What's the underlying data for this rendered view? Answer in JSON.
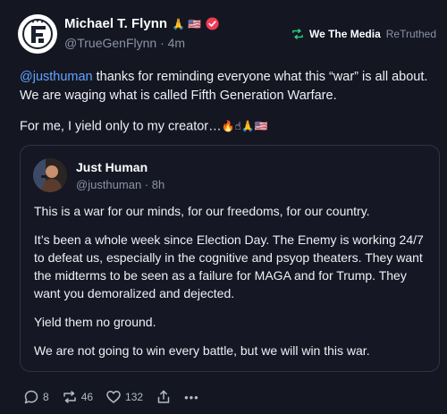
{
  "author": {
    "name": "Michael T. Flynn",
    "name_emojis": "🙏 🇺🇸",
    "handle": "@TrueGenFlynn",
    "time": "4m",
    "separator": "·"
  },
  "retruth": {
    "account": "We The Media",
    "label": "ReTruthed"
  },
  "post": {
    "mention": "@justhuman",
    "line1_rest": " thanks for reminding everyone what this “war” is all about. We are waging what is called Fifth Generation Warfare.",
    "line2": "For me, I yield only to my creator…",
    "line2_emojis": "🔥☝🙏🇺🇸"
  },
  "quote": {
    "name": "Just Human",
    "handle": "@justhuman",
    "time": "8h",
    "separator": "·",
    "paragraphs": [
      "This is a war for our minds, for our freedoms, for our country.",
      "It’s been a whole week since Election Day. The Enemy is working 24/7 to defeat us, especially in the cognitive and psyop theaters. They want the midterms to be seen as a failure for MAGA and for Trump. They want you demoralized and dejected.",
      "Yield them no ground.",
      "We are not going to win every battle, but we will win this war."
    ]
  },
  "actions": {
    "replies": "8",
    "retruths": "46",
    "likes": "132",
    "more": "•••"
  },
  "colors": {
    "background": "#141722",
    "mention": "#63a3ff",
    "retruth_icon": "#2bd47f",
    "verified": "#ef3b55"
  }
}
